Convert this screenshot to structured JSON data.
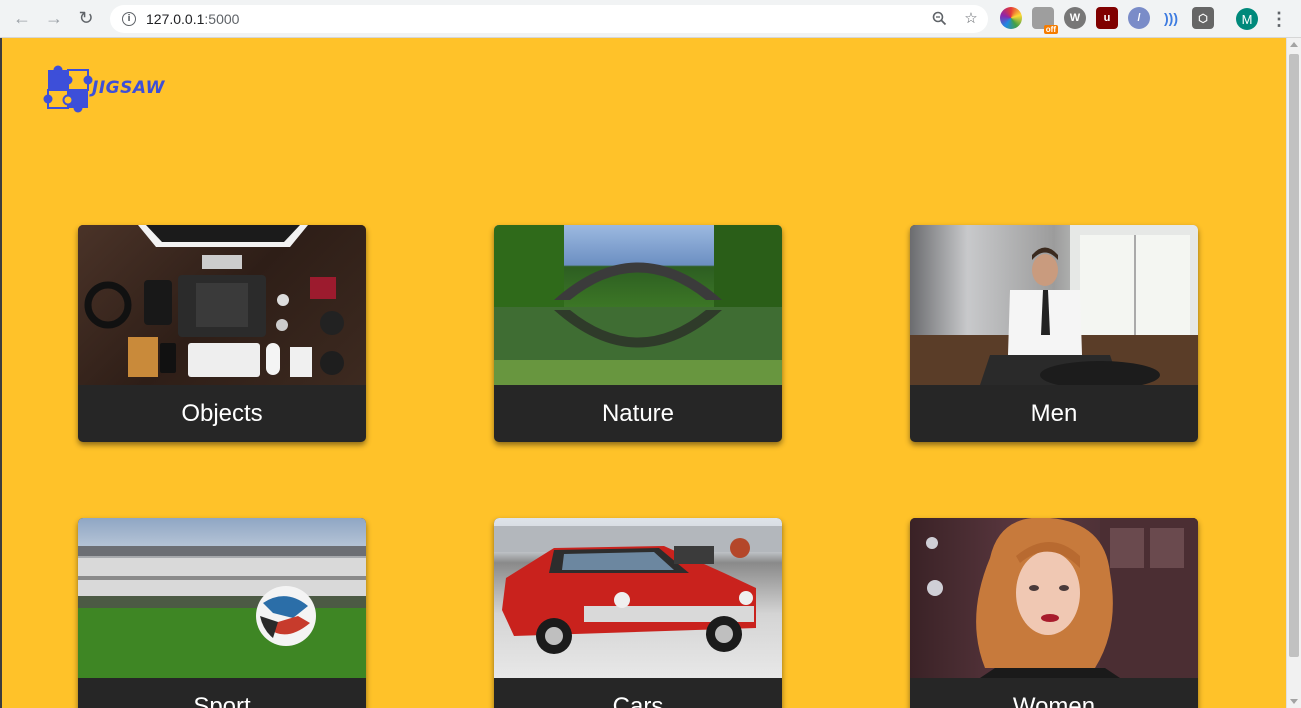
{
  "browser": {
    "url_host": "127.0.0.1",
    "url_port": ":5000",
    "profile_initial": "M",
    "extension_badge": "off"
  },
  "site": {
    "logo_text": "JIGSAW",
    "brand_color": "#3d4fd9",
    "background_color": "#ffc229"
  },
  "categories": [
    {
      "label": "Objects"
    },
    {
      "label": "Nature"
    },
    {
      "label": "Men"
    },
    {
      "label": "Sport"
    },
    {
      "label": "Cars"
    },
    {
      "label": "Women"
    }
  ]
}
